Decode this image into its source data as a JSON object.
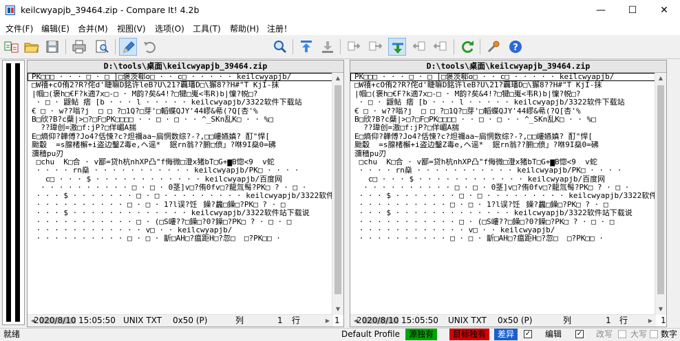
{
  "window": {
    "title": "keilcwyapjb_39464.zip - Compare It! 4.2b",
    "minimize": "—",
    "maximize": "☐",
    "close": "✕"
  },
  "menu": [
    "文件(F)",
    "编辑(E)",
    "合并(M)",
    "视图(V)",
    "选项(O)",
    "工具(T)",
    "帮助(H)",
    "注册！"
  ],
  "toolbar": {
    "search_value": ""
  },
  "left_pane": {
    "header": "D:\\tools\\桌面\\keilcwyapjb_39464.zip",
    "lines": [
      "PK□□□ · · · □ · □ |□褒茨郗o□ · · c□ · · · · · keilcwyapjb/",
      "□W禧+cO侑2?R?侘d'睫嘛D銘许leB?U\\21?覊璠D□\\獬8??H#\"T KjI-抹",
      "|帼□(褒h□€F?k適7x□-□ · M韵?矣&4!?□犍□嵬<韦R)b|懍?帨□?",
      " · □ · 鼴鲇 痞 [b · · · l · · · · · keilcwyapjb/3322软件下载站",
      "€ □ · w??嗡?j  □ □ ?□1Q?□芽'□轁蝶QJY'44嵺&㣇(?Q[杏'%",
      "B□欣?B?c蘗|>□?□F□PK□□□□ · · □ · □ · · ^_SKn乱K□ · · %□",
      "  ??瑋创=滶□f:jP?□佯嵋A揣",
      "E□熵仰?韡傅?Jo4?佸悚?c?炟禰aa~扃惘数综?-?,□□嶁嬿嫃? 酊\"悍[",
      "颱觳  =s腺楮檞+i盗边鑿Z毒e,ヘ谣*  鈱rn翁??腑□偾」?咻9I燊0=砩",
      "瀰穡pu刃",
      " □chu  K□合 · v鄙=贷h杭nhXP凸\"f侮微□澄x猪bT□G+▆B惚<9  v蛇",
      " · · · · rn燊 · · · · · · · · · · · keilcwyapjb/PK□ · · · ·",
      "   c□ · · · $ · · · · · · · · · · · · keilcwyapjb/百度网",
      "  · · · · · · · · · · □ · □ · 0茎]v□?侑0fv□?龍氚髩?PK□ ? · □ ·",
      " · · · $ · · · · · · · □ · □ · · · · · · · · · keilcwyapjb/3322软件下载站.",
      " · · · · · · · · · · □ · □ · 1?l误?饪鐰?蠿□鐰□?PK□ ? · □",
      " · · · $ · · · · · · · · · · · · · keilcwyapjb/3322软件站下载说",
      " · · · · · · · · · · · □ · (□S嶁??□鐰□?0?鐰□?PK□ ? · □ · □",
      " · · · · · · · · · · · · v□ · · keilcwyapjb/",
      " · · · · · · · · · · □ · □ · 齗□AH□?瘟距H□?忽□  □?PK□□ ·"
    ]
  },
  "right_pane": {
    "header": "D:\\tools\\桌面\\keilcwyapjb_39464.zip",
    "lines": [
      "PK□□□ · · · □ · □ |□褒茨郗o□ · · c□ · · · · · keilcwyapjb/",
      "□W禧+cO侑2?R?侘d'睫嘛D銘许leB?U\\21?覊璠D□\\獬8??H#\"T KjI-抹",
      "|帼□(褒h□€F?k適7x□-□ · M韵?矣&4!?□犍□嵬<韦R)b|懍?帨□?",
      " · □ · 鼴鲇 痞 [b · · · l · · · · · keilcwyapjb/3322软件下载站",
      "€ □ · w??嗡?j  □ □ ?□1Q?□芽'□轁蝶QJY'44嵺&㣇(?Q[杏'%",
      "B□欣?B?c蘗|>□?□F□PK□□□□ · · □ · □ · · ^_SKn乱K□ · · %□",
      "  ??瑋创=滶□f:jP?□佯嵋A揣",
      "E□熵仰?韡傅?Jo4?佸悚?c?炟禰aa~扃惘数综?-?,□□嶁嬿嫃? 酊\"悍[",
      "颱觳  =s腺楮檞+i盗边鑿Z毒e,ヘ谣*  鈱rn翁??腑□偾」?咻9I燊0=砩",
      "瀰穡pu刃",
      " □chu  K□合 · v鄙=贷h杭nhXP凸\"f侮微□澄x猪bT□G+▆B惚<9  v蛇",
      " · · · · rn燊 · · · · · · · · · · · keilcwyapjb/PK□ · · · ·",
      "   c□ · · · $ · · · · · · · · · · · · keilcwyapjb/百度网",
      "  · · · · · · · · · · □ · □ · 0茎]v□?侑0fv□?龍氚髩?PK□ ? · □ ·",
      " · · · $ · · · · · · · □ · □ · · · · · · · · · keilcwyapjb/3322软件下载站.",
      " · · · · · · · · · · □ · □ · 1?l误?饪鐰?蠿□鐰□?PK□ ? · □",
      " · · · $ · · · · · · · · · · · · · keilcwyapjb/3322软件站下载说",
      " · · · · · · · · · · · □ · (□S嶁??□鐰□?0?鐰□?PK□ ? · □ · □",
      " · · · · · · · · · · · · v□ · · keilcwyapjb/",
      " · · · · · · · · · · □ · □ · 齗□AH□?瘟距H□?忽□  □?PK□□ ·"
    ]
  },
  "left_status": {
    "date": "2020/8/10",
    "time": "15:05:50",
    "format": "UNIX TXT",
    "offset": "0x50 (P)",
    "col_label": "列",
    "col": "1",
    "row_label": "行",
    "row": "1"
  },
  "right_status": {
    "date": "2020/8/10",
    "time": "15:05:50",
    "format": "UNIX TXT",
    "offset": "0x50 (P)",
    "col_label": "列",
    "col": "1",
    "row_label": "行",
    "row": "1"
  },
  "statusbar": {
    "ready": "就绪",
    "profile": "Default Profile",
    "source_only": "源独有",
    "target_only": "目标独有",
    "diff": "差异",
    "edit": "编辑",
    "rewrite": "改写",
    "caps": "大写",
    "num": "数字",
    "colors": {
      "source_only": "#00a400",
      "target_only": "#d40000",
      "diff": "#1a5fd1"
    }
  }
}
